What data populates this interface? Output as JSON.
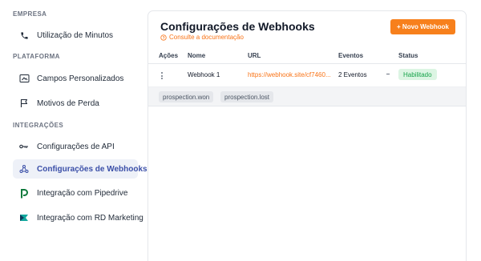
{
  "sidebar": {
    "sections": [
      {
        "title": "EMPRESA"
      },
      {
        "title": "PLATAFORMA"
      },
      {
        "title": "INTEGRAÇÕES"
      }
    ],
    "items": [
      {
        "label": "Utilização de Minutos",
        "icon": "phone-icon"
      },
      {
        "label": "Campos Personalizados",
        "icon": "custom-fields-icon"
      },
      {
        "label": "Motivos de Perda",
        "icon": "flag-icon"
      },
      {
        "label": "Configurações de API",
        "icon": "key-icon"
      },
      {
        "label": "Configurações de Webhooks",
        "icon": "webhook-icon",
        "active": true
      },
      {
        "label": "Integração com Pipedrive",
        "icon": "pipedrive-logo-icon"
      },
      {
        "label": "Integração com RD Marketing",
        "icon": "rd-station-logo-icon"
      }
    ]
  },
  "main": {
    "title": "Configurações de Webhooks",
    "doc_link": "Consulte a documentação",
    "new_button": "+ Novo Webhook",
    "columns": [
      "Ações",
      "Nome",
      "URL",
      "Eventos",
      "Status"
    ],
    "rows": [
      {
        "name": "Webhook 1",
        "url": "https://webhook.site/cf7460...",
        "events": "2 Eventos",
        "status": "Habilitado",
        "event_tags": [
          "prospection.won",
          "prospection.lost"
        ]
      }
    ]
  },
  "colors": {
    "accent": "#f7801c",
    "active_nav_text": "#3b4fa8",
    "status_enabled": "#16a34a"
  }
}
